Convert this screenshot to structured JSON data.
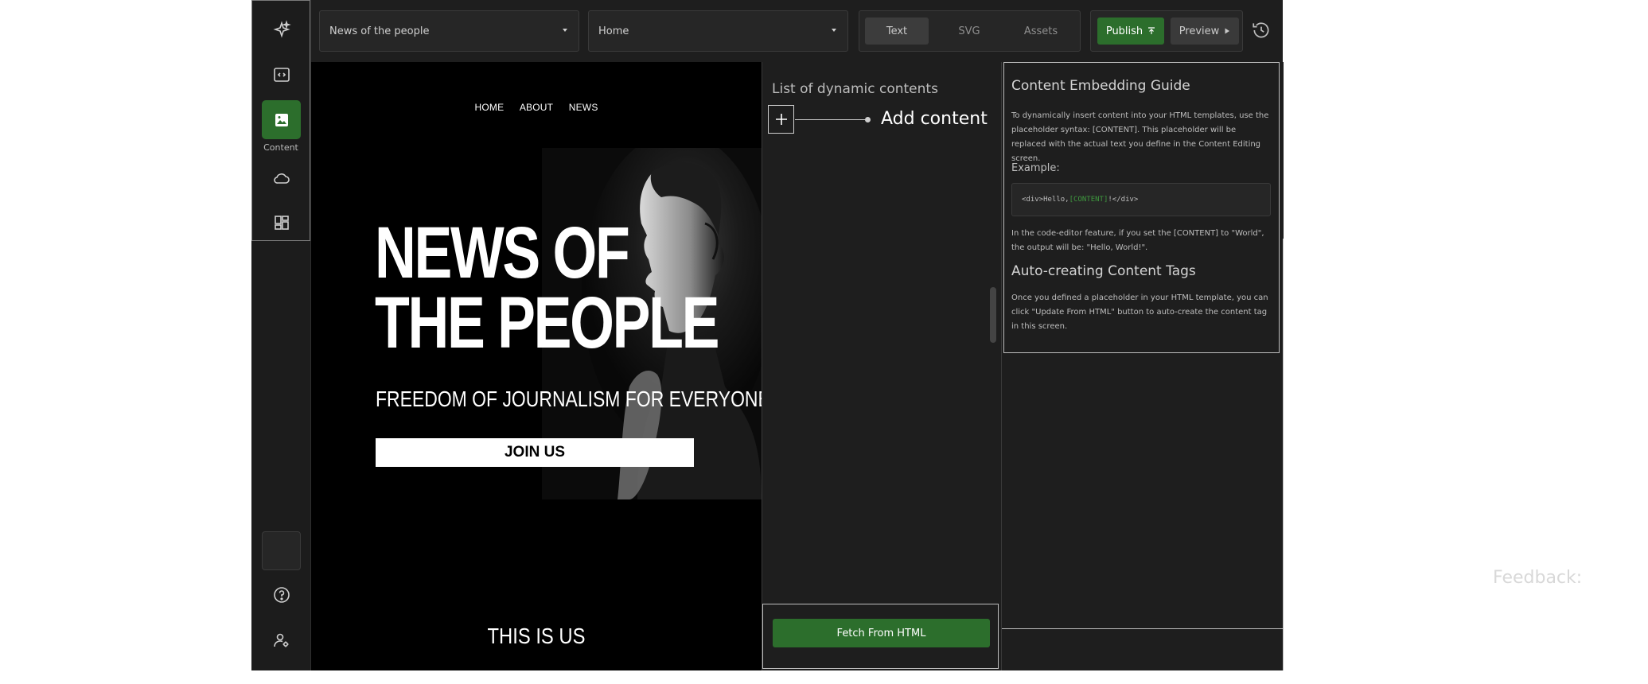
{
  "topbar": {
    "project_select": "News of the people",
    "page_select": "Home",
    "tabs": [
      {
        "label": "Text",
        "active": true
      },
      {
        "label": "SVG",
        "active": false
      },
      {
        "label": "Assets",
        "active": false
      }
    ],
    "publish_label": "Publish",
    "preview_label": "Preview"
  },
  "rail": {
    "active_label": "Content"
  },
  "preview": {
    "nav": [
      "HOME",
      "ABOUT",
      "NEWS"
    ],
    "hero_title_1": "NEWS OF",
    "hero_title_2": "THE PEOPLE",
    "hero_subtitle": "FREEDOM OF JOURNALISM FOR EVERYONE",
    "join_label": "JOIN US",
    "section_heading": "THIS IS US"
  },
  "dynamic": {
    "title": "List of dynamic contents",
    "add_label": "Add content",
    "fetch_label": "Fetch From HTML"
  },
  "guide": {
    "title": "Content Embedding Guide",
    "intro": "To dynamically insert content into your HTML templates, use the placeholder syntax: [CONTENT]. This placeholder will be replaced with the actual text you define in the Content Editing screen.",
    "example_label": "Example:",
    "code_prefix": "<div>Hello, ",
    "code_placeholder": "[CONTENT]",
    "code_suffix": "!</div>",
    "result_text": "In the code-editor feature, if you set the [CONTENT] to \"World\", the output will be: \"Hello, World!\".",
    "auto_title": "Auto-creating Content Tags",
    "auto_text": "Once you defined a placeholder in your HTML template, you can click \"Update From HTML\" button to auto-create the content tag in this screen."
  },
  "feedback_label": "Feedback:",
  "colors": {
    "accent_green": "#2c6e2c",
    "panel_bg": "#1e1e1e",
    "code_highlight": "#3f9a3f"
  }
}
